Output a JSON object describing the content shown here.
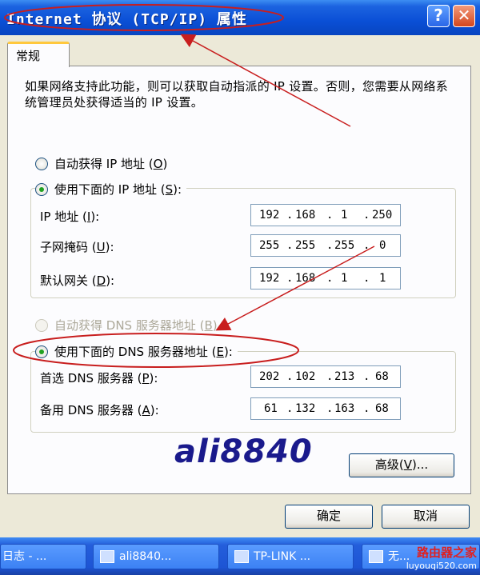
{
  "window": {
    "title": "Internet 协议 (TCP/IP) 属性",
    "help_icon": "?",
    "close_icon": "✕"
  },
  "tab": {
    "label": "常规"
  },
  "description": "如果网络支持此功能，则可以获取自动指派的 IP 设置。否则，您需要从网络系统管理员处获得适当的 IP 设置。",
  "ip": {
    "auto_label": "自动获得 IP 地址",
    "auto_key": "O",
    "auto_selected": false,
    "manual_label": "使用下面的 IP 地址",
    "manual_key": "S",
    "manual_selected": true,
    "fields": [
      {
        "label": "IP 地址",
        "key": "I",
        "octets": [
          "192",
          "168",
          "1",
          "250"
        ]
      },
      {
        "label": "子网掩码",
        "key": "U",
        "octets": [
          "255",
          "255",
          "255",
          "0"
        ]
      },
      {
        "label": "默认网关",
        "key": "D",
        "octets": [
          "192",
          "168",
          "1",
          "1"
        ]
      }
    ]
  },
  "dns": {
    "auto_label": "自动获得 DNS 服务器地址",
    "auto_key": "B",
    "auto_selected": false,
    "auto_disabled": true,
    "manual_label": "使用下面的 DNS 服务器地址",
    "manual_key": "E",
    "manual_selected": true,
    "fields": [
      {
        "label": "首选 DNS 服务器",
        "key": "P",
        "octets": [
          "202",
          "102",
          "213",
          "68"
        ]
      },
      {
        "label": "备用 DNS 服务器",
        "key": "A",
        "octets": [
          "61",
          "132",
          "163",
          "68"
        ]
      }
    ]
  },
  "watermark": "ali8840",
  "buttons": {
    "advanced": "高级",
    "advanced_key": "V",
    "advanced_suffix": "...",
    "ok": "确定",
    "cancel": "取消"
  },
  "taskbar": {
    "items": [
      "日志 - ...",
      "ali8840...",
      "TP-LINK ...",
      "无..."
    ],
    "logo_line1": "路由器之家",
    "logo_line2": "luyouqi520.com"
  },
  "colors": {
    "titlebar": "#0a4fd6",
    "annotation": "#c81e1e",
    "radio_dot": "#21a121"
  }
}
